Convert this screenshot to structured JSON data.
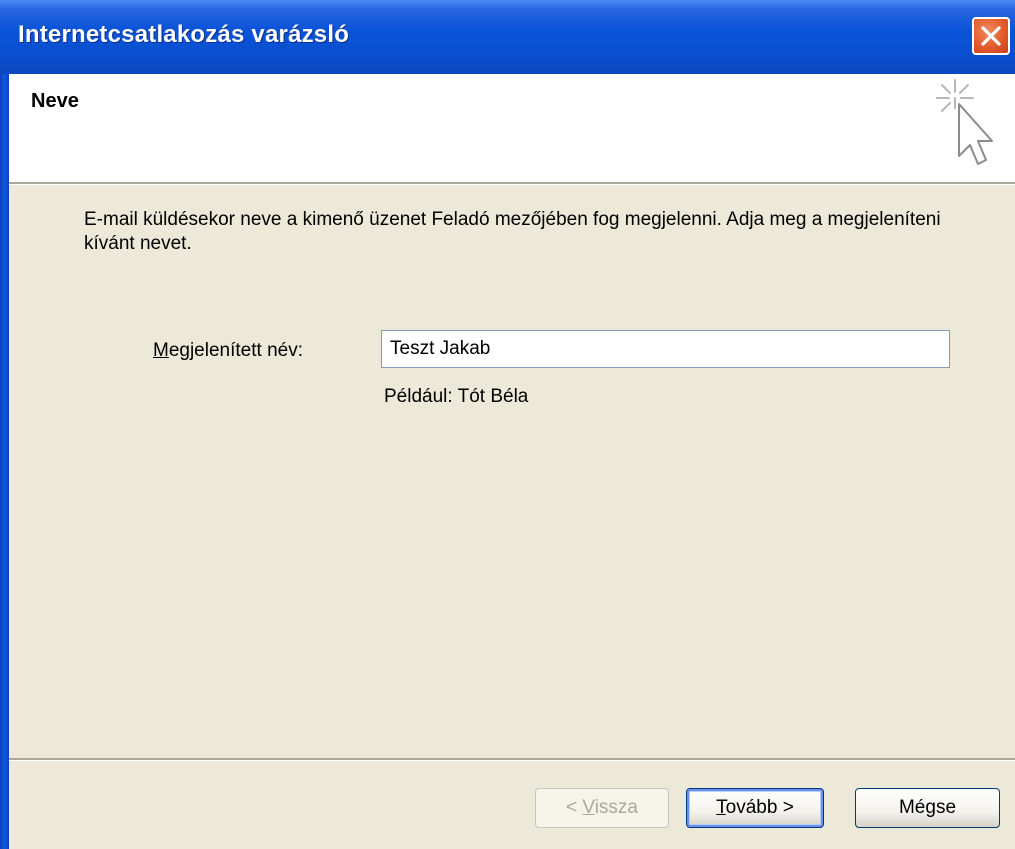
{
  "window": {
    "title": "Internetcsatlakozás varázsló"
  },
  "header": {
    "title": "Neve"
  },
  "content": {
    "description": "E-mail küldésekor neve a kimenő üzenet Feladó mezőjében fog megjelenni. Adja meg a megjeleníteni kívánt nevet.",
    "name_label_accel": "M",
    "name_label_rest": "egjelenített név:",
    "name_value": "Teszt Jakab",
    "example": "Például: Tót Béla"
  },
  "buttons": {
    "back_prefix": "< ",
    "back_accel": "V",
    "back_rest": "issza",
    "next_accel": "T",
    "next_rest": "ovább >",
    "cancel": "Mégse"
  },
  "colors": {
    "title_bar": "#0a53d8",
    "close_button": "#e35b2b",
    "dialog_background": "#ece9d8",
    "header_background": "#ffffff"
  },
  "icons": {
    "close": "close-x-icon",
    "wizard": "cursor-sparkle-icon"
  }
}
